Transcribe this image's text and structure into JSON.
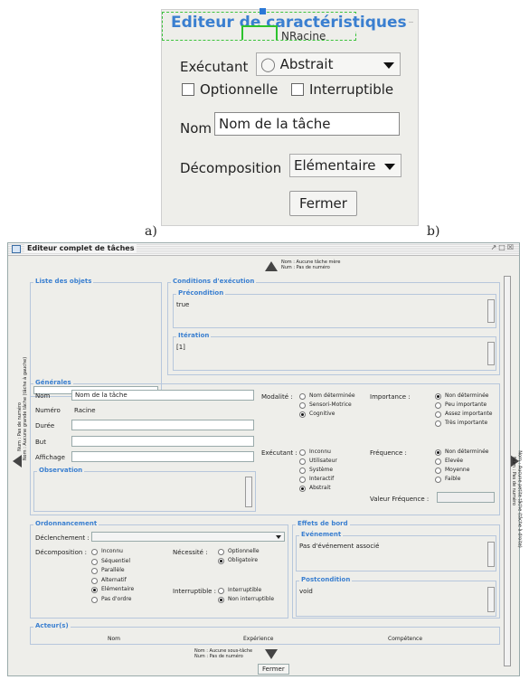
{
  "figure_labels": {
    "a": "a)",
    "b": "b)"
  },
  "panel_a": {
    "title": "Editeur de caractéristiques",
    "node_label": "NRacine",
    "executant_label": "Exécutant",
    "executant_value": "Abstrait",
    "optional_label": "Optionnelle",
    "interruptible_label": "Interruptible",
    "name_label": "Nom",
    "name_value": "Nom de la tâche",
    "decomposition_label": "Décomposition",
    "decomposition_value": "Elémentaire",
    "close_label": "Fermer"
  },
  "panel_b": {
    "window_title": "Editeur complet de tâches",
    "parent_name": "Nom : Aucune tâche mère",
    "parent_num": "Num : Pas de numéro",
    "left_name": "Nom : Aucune grande tâche (tâche à gauche)",
    "left_num": "Num : Pas de numéro",
    "right_name": "Nom : Aucune petite tâche (tâche à droite)",
    "right_num": "Num : Pas de numéro",
    "child_name": "Nom : Aucune sous-tâche",
    "child_num": "Num : Pas de numéro",
    "objects_title": "Liste des objets",
    "conditions_title": "Conditions d'exécution",
    "precondition_title": "Précondition",
    "precondition_value": "true",
    "iteration_title": "Itération",
    "iteration_value": "[1]",
    "general_title": "Générales",
    "nom_label": "Nom",
    "nom_value": "Nom de la tâche",
    "numero_label": "Numéro",
    "numero_value": "Racine",
    "duree_label": "Durée",
    "but_label": "But",
    "affichage_label": "Affichage",
    "observation_title": "Observation",
    "modalite_label": "Modalité :",
    "modalite_options": [
      "Nom déterminée",
      "Sensori-Motrice",
      "Cognitive"
    ],
    "importance_label": "Importance :",
    "importance_options": [
      "Non déterminée",
      "Peu importante",
      "Assez importante",
      "Très importante"
    ],
    "executant_label": "Exécutant :",
    "executant_options": [
      "Inconnu",
      "Utilisateur",
      "Système",
      "Interactif",
      "Abstrait"
    ],
    "frequence_label": "Fréquence :",
    "frequence_options": [
      "Non déterminée",
      "Elevée",
      "Moyenne",
      "Faible"
    ],
    "valeur_freq_label": "Valeur Fréquence :",
    "ordonnancement_title": "Ordonnancement",
    "declenchement_label": "Déclenchement :",
    "decomposition_label": "Décomposition :",
    "decomposition_options": [
      "Inconnu",
      "Séquentiel",
      "Parallèle",
      "Alternatif",
      "Elémentaire",
      "Pas d'ordre"
    ],
    "necessite_label": "Nécessité :",
    "necessite_options": [
      "Optionnelle",
      "Obligatoire"
    ],
    "interruptible_label": "Interruptible :",
    "interruptible_options": [
      "Interruptible",
      "Non interruptible"
    ],
    "effets_title": "Effets de bord",
    "evenement_title": "Evénement",
    "evenement_value": "Pas d'événement associé",
    "postcondition_title": "Postcondition",
    "postcondition_value": "void",
    "acteurs_title": "Acteur(s)",
    "acteurs_columns": [
      "Nom",
      "Expérience",
      "Compétence"
    ],
    "close_label": "Fermer"
  }
}
